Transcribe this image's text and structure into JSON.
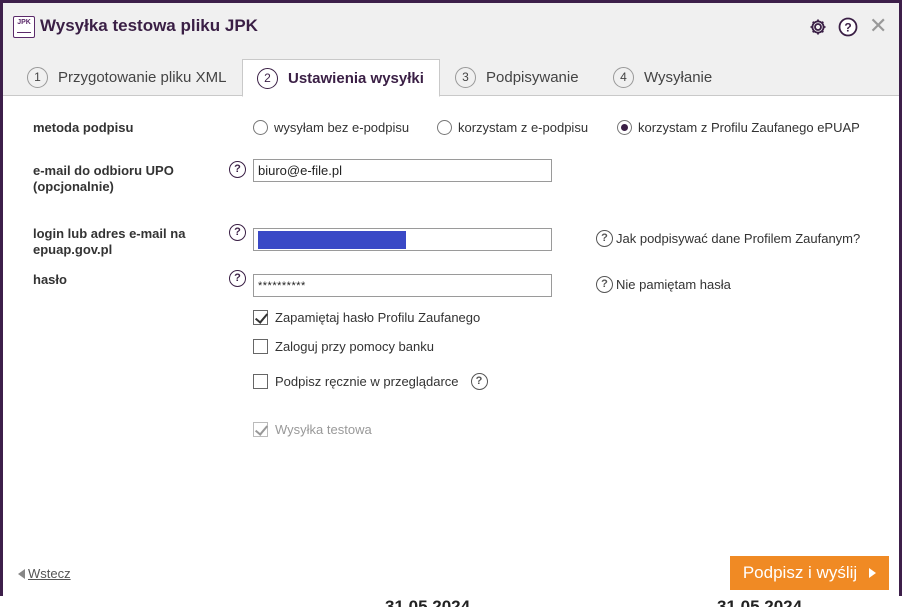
{
  "window": {
    "title": "Wysyłka testowa pliku JPK",
    "logo_text": "JPK",
    "icons": [
      "gear-icon",
      "help-icon",
      "close-icon"
    ]
  },
  "tabs": [
    {
      "num": "1",
      "label": "Przygotowanie pliku XML",
      "active": false
    },
    {
      "num": "2",
      "label": "Ustawienia wysyłki",
      "active": true
    },
    {
      "num": "3",
      "label": "Podpisywanie",
      "active": false
    },
    {
      "num": "4",
      "label": "Wysyłanie",
      "active": false
    }
  ],
  "form": {
    "method_label": "metoda podpisu",
    "method_options": [
      {
        "label": "wysyłam bez e-podpisu",
        "selected": false
      },
      {
        "label": "korzystam z e-podpisu",
        "selected": false
      },
      {
        "label": "korzystam z Profilu Zaufanego ePUAP",
        "selected": true
      }
    ],
    "email_label_1": "e-mail do odbioru UPO",
    "email_label_2": "(opcjonalnie)",
    "email_value": "biuro@e-file.pl",
    "login_label_1": "login lub adres e-mail na",
    "login_label_2": "epuap.gov.pl",
    "login_value": "",
    "login_help_link": "Jak podpisywać dane Profilem Zaufanym?",
    "password_label": "hasło",
    "password_value": "**********",
    "password_help_link": "Nie pamiętam hasła",
    "checkboxes": [
      {
        "label": "Zapamiętaj hasło Profilu Zaufanego",
        "checked": true,
        "disabled": false
      },
      {
        "label": "Zaloguj przy pomocy banku",
        "checked": false,
        "disabled": false
      },
      {
        "label": "Podpisz ręcznie w przeglądarce",
        "checked": false,
        "disabled": false
      },
      {
        "label": "Wysyłka testowa",
        "checked": true,
        "disabled": true
      }
    ],
    "help_glyph": "?"
  },
  "footer": {
    "back_label": "Wstecz",
    "submit_label": "Podpisz i wyślij"
  },
  "background": {
    "date_left": "31.05.2024",
    "date_right": "31.05.2024"
  },
  "colors": {
    "accent": "#3a1f45",
    "submit": "#f08a24",
    "redaction": "#3a49c6"
  }
}
